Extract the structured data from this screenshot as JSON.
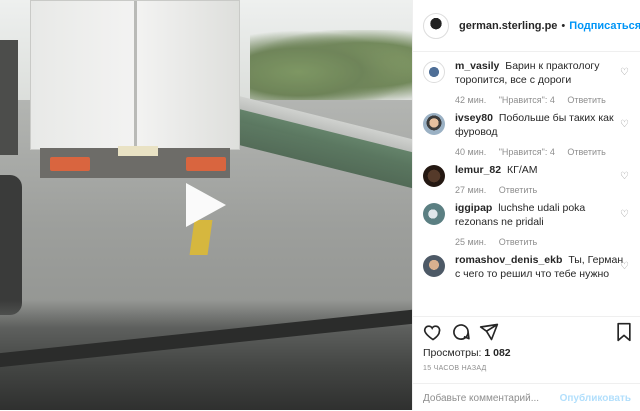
{
  "header": {
    "username": "german.sterling.pe",
    "separator": "•",
    "follow_label": "Подписаться"
  },
  "comments": [
    {
      "user": "m_vasily",
      "text": "Барин к практологу торопится, все с дороги",
      "time": "42 мин.",
      "likes": "\"Нравится\": 4",
      "reply": "Ответить"
    },
    {
      "user": "ivsey80",
      "text": "Побольше бы таких как фуровод",
      "time": "40 мин.",
      "likes": "\"Нравится\": 4",
      "reply": "Ответить"
    },
    {
      "user": "lemur_82",
      "text": "КГ/АМ",
      "time": "27 мин.",
      "reply": "Ответить"
    },
    {
      "user": "iggipap",
      "text": "luchshe udali poka rezonans ne pridali",
      "time": "25 мин.",
      "reply": "Ответить"
    },
    {
      "user": "romashov_denis_ekb",
      "text": "Ты, Герман с чего то решил что тебе нужно"
    }
  ],
  "stats": {
    "views_label": "Просмотры:",
    "views_count": "1 082",
    "posted_ago": "15 ЧАСОВ НАЗАД"
  },
  "add_comment": {
    "placeholder": "Добавьте комментарий...",
    "publish_label": "Опубликовать"
  },
  "icons": {
    "like": "heart-icon",
    "comment": "comment-icon",
    "share": "share-icon",
    "save": "bookmark-icon",
    "comment_like": "small-heart-icon",
    "video_control": "play-icon"
  },
  "colors": {
    "accent": "#0095f6",
    "publish_disabled": "#b2dffc",
    "meta_text": "#8e8e8e",
    "primary_text": "#262626"
  }
}
